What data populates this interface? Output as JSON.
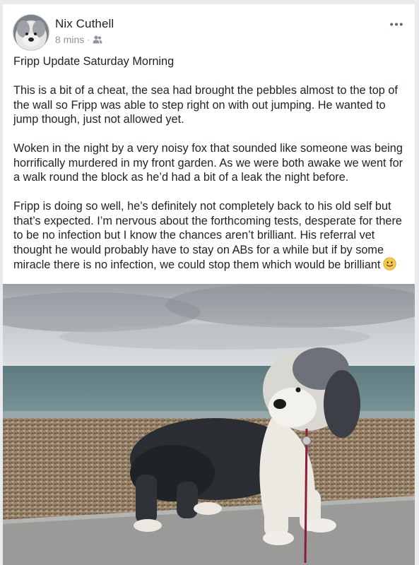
{
  "post": {
    "author": "Nix Cuthell",
    "time": "8 mins",
    "separator": "·",
    "audience_icon": "friends-icon",
    "more_icon": "more-horizontal-icon",
    "paragraphs": [
      "Fripp Update Saturday Morning",
      "This is a bit of a cheat, the sea had brought the pebbles almost to the top of the wall so Fripp was able to step right on with out jumping. He wanted to jump though, just not allowed yet.",
      "Woken in the night by a very noisy fox that sounded like someone was being horrifically murdered in my front garden. As we were both awake we went for a walk round the block as he’d had a bit of a leak the night before.",
      "Fripp is doing so well, he’s definitely not completely back to his old self but that’s expected. I’m nervous about the forthcoming tests, desperate for there to be no infection but I know the chances aren’t brilliant. His referral vet thought he would probably have to stay on ABs for a while but if by some miracle there is no infection, we could stop them which would be brilliant"
    ],
    "emoji": "slightly-smiling-face-emoji"
  },
  "colors": {
    "text": "#1d2129",
    "meta": "#90949c",
    "background": "#e9ebee",
    "card": "#ffffff"
  }
}
